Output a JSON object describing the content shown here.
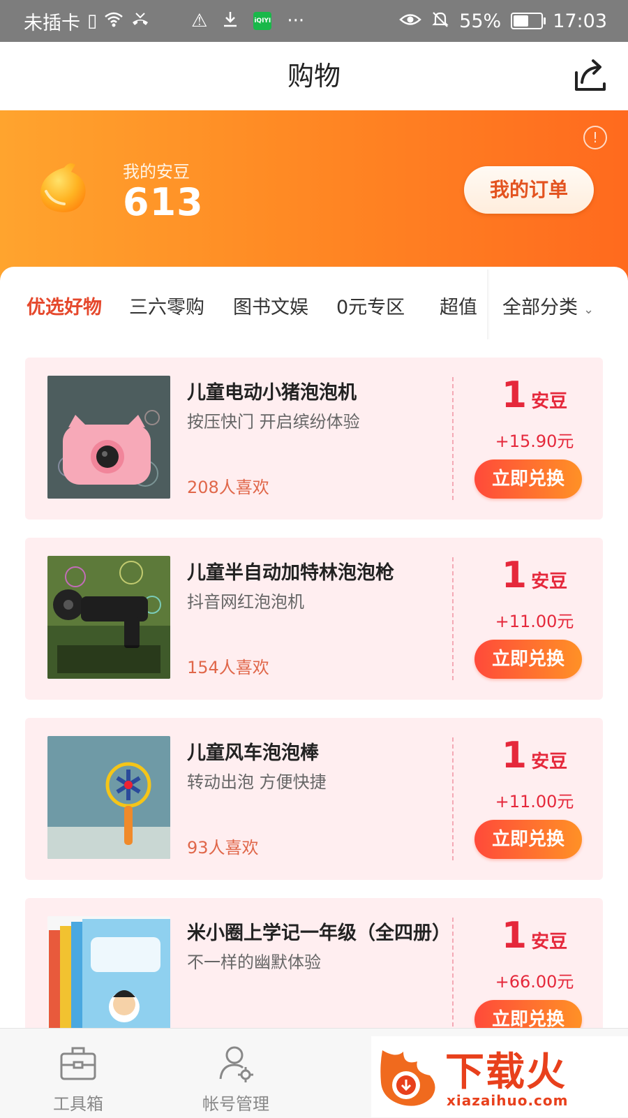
{
  "status_bar": {
    "carrier": "未插卡",
    "battery_percent": "55%",
    "time": "17:03",
    "battery_level": 0.55,
    "icons": [
      "sim-alert-icon",
      "wifi-icon",
      "missed-call-icon",
      "warning-icon",
      "download-icon",
      "iqiyi-icon",
      "more-dots-icon",
      "eye-icon",
      "mute-bell-icon",
      "battery-icon"
    ]
  },
  "header": {
    "title": "购物",
    "share_icon": "share-icon"
  },
  "banner": {
    "label": "我的安豆",
    "count": "613",
    "order_button": "我的订单",
    "info_icon": "info-icon",
    "info_symbol": "!"
  },
  "tabs": {
    "items": [
      "优选好物",
      "三六零购",
      "图书文娱",
      "0元专区",
      "超值"
    ],
    "active_index": 0,
    "all_label": "全部分类",
    "all_chevron": "⌄"
  },
  "products": [
    {
      "name": "儿童电动小猪泡泡机",
      "desc": "按压快门 开启缤纷体验",
      "likes": "208人喜欢",
      "price": "1",
      "unit": "安豆",
      "plus": "+15.90元",
      "button": "立即兑换"
    },
    {
      "name": "儿童半自动加特林泡泡枪",
      "desc": "抖音网红泡泡机",
      "likes": "154人喜欢",
      "price": "1",
      "unit": "安豆",
      "plus": "+11.00元",
      "button": "立即兑换"
    },
    {
      "name": "儿童风车泡泡棒",
      "desc": "转动出泡 方便快捷",
      "likes": "93人喜欢",
      "price": "1",
      "unit": "安豆",
      "plus": "+11.00元",
      "button": "立即兑换"
    },
    {
      "name": "米小圈上学记一年级（全四册）",
      "desc": "不一样的幽默体验",
      "likes": "",
      "price": "1",
      "unit": "安豆",
      "plus": "+66.00元",
      "button": "立即兑换"
    }
  ],
  "bottom_nav": [
    {
      "label": "工具箱",
      "icon": "toolbox-icon"
    },
    {
      "label": "帐号管理",
      "icon": "account-settings-icon"
    }
  ],
  "watermark": {
    "text": "下载火",
    "url": "xiazaihuo.com"
  },
  "colors": {
    "accent": "#e5482c",
    "banner_start": "#ffa42e",
    "banner_end": "#ff6a1e",
    "price_red": "#e5283b",
    "card_bg": "#ffeef0"
  }
}
